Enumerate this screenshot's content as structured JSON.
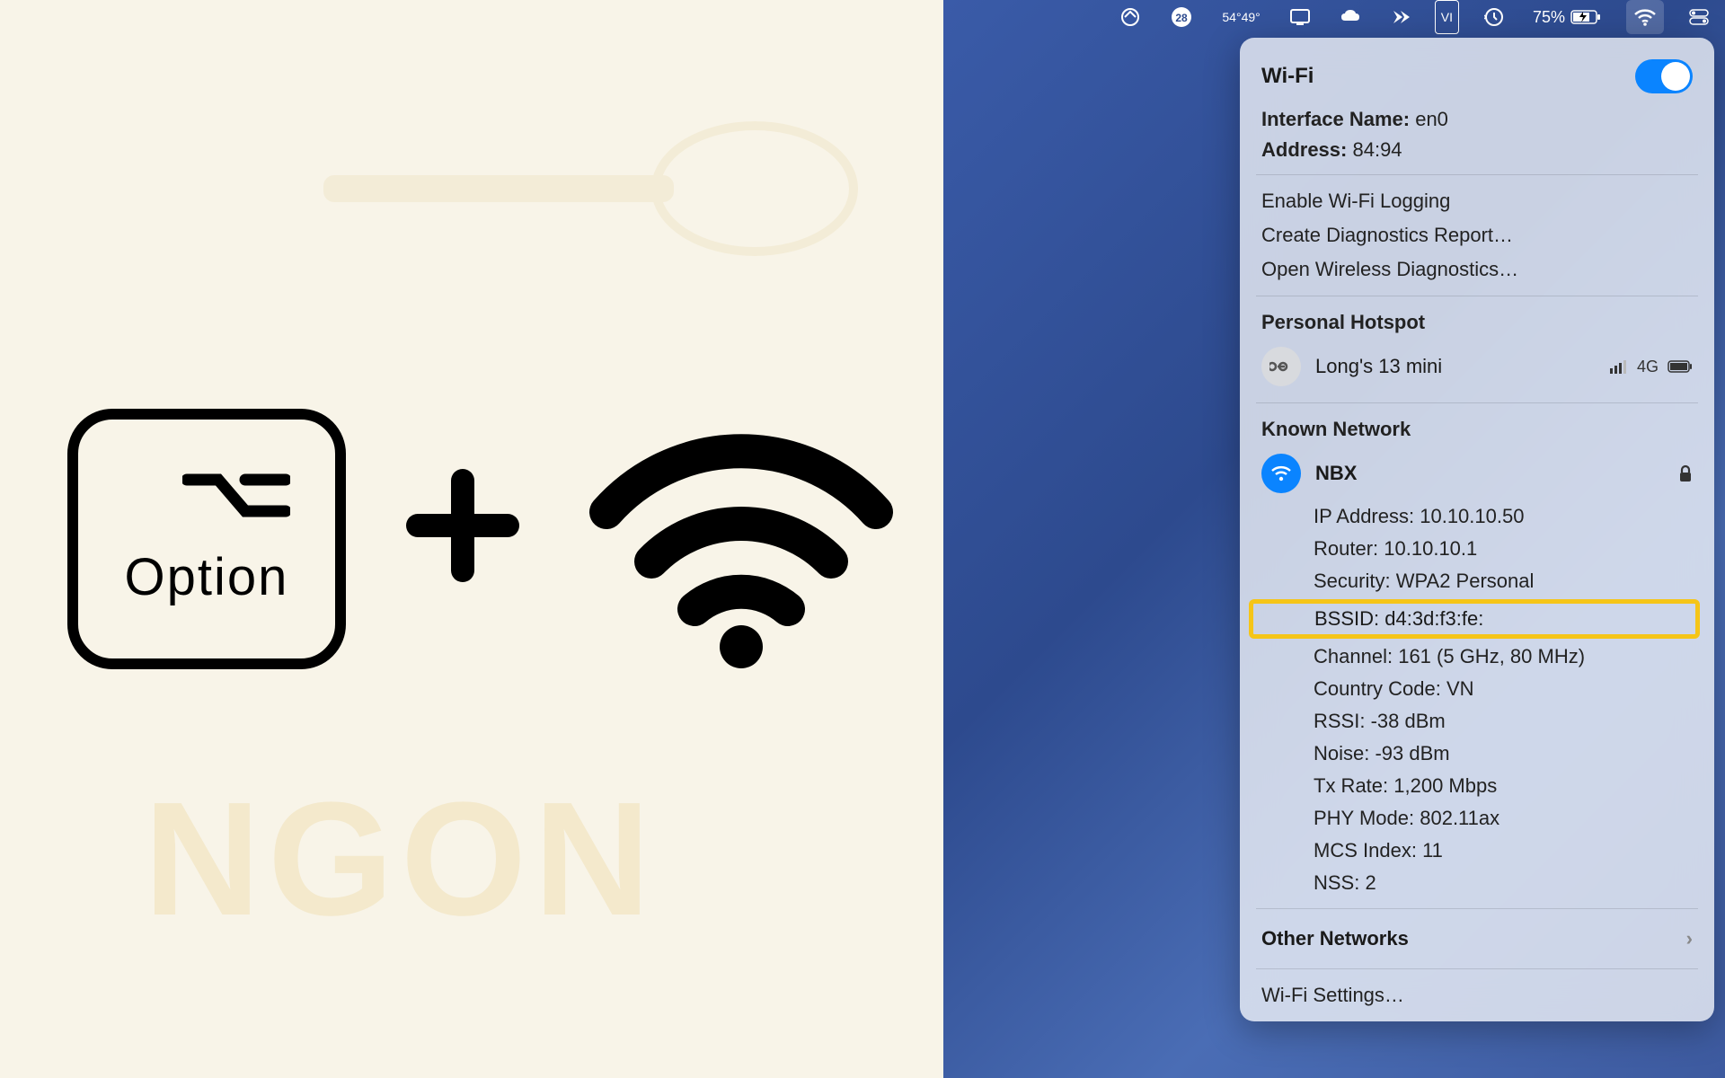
{
  "leftPanel": {
    "keyLabel": "Option",
    "watermark": "NGON"
  },
  "menubar": {
    "tempHigh": "54°",
    "tempLow": "49°",
    "input": "VI",
    "battery": "75%"
  },
  "dropdown": {
    "title": "Wi-Fi",
    "interfaceLabel": "Interface Name:",
    "interfaceValue": "en0",
    "addressLabel": "Address:",
    "addressValue": "84:94",
    "enableLogging": "Enable Wi-Fi Logging",
    "createReport": "Create Diagnostics Report…",
    "openDiagnostics": "Open Wireless Diagnostics…",
    "personalHotspot": "Personal Hotspot",
    "hotspotName": "Long's 13 mini",
    "hotspotType": "4G",
    "knownNetwork": "Known Network",
    "networkName": "NBX",
    "details": {
      "ipLabel": "IP Address:",
      "ipValue": "10.10.10.50",
      "routerLabel": "Router:",
      "routerValue": "10.10.10.1",
      "securityLabel": "Security:",
      "securityValue": "WPA2 Personal",
      "bssidLabel": "BSSID:",
      "bssidValue": "d4:3d:f3:fe:",
      "channelLabel": "Channel:",
      "channelValue": "161 (5 GHz, 80 MHz)",
      "countryLabel": "Country Code:",
      "countryValue": "VN",
      "rssiLabel": "RSSI:",
      "rssiValue": "-38 dBm",
      "noiseLabel": "Noise:",
      "noiseValue": "-93 dBm",
      "txLabel": "Tx Rate:",
      "txValue": "1,200 Mbps",
      "phyLabel": "PHY Mode:",
      "phyValue": "802.11ax",
      "mcsLabel": "MCS Index:",
      "mcsValue": "11",
      "nssLabel": "NSS:",
      "nssValue": "2"
    },
    "otherNetworks": "Other Networks",
    "wifiSettings": "Wi-Fi Settings…"
  }
}
